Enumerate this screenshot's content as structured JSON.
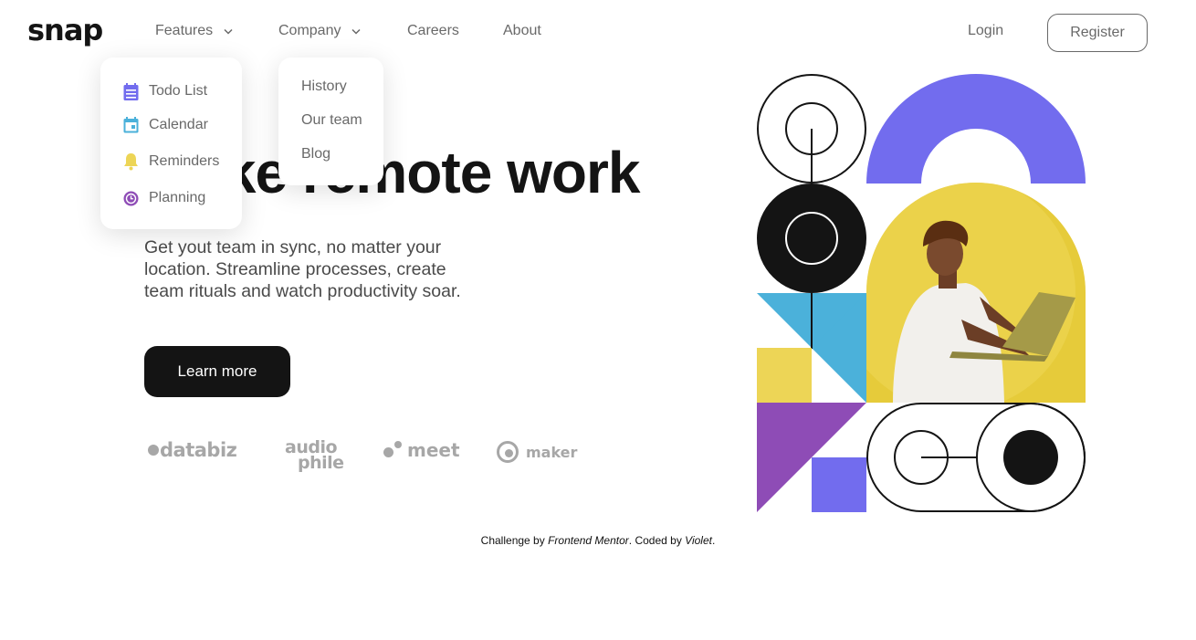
{
  "brand": {
    "logo": "snap"
  },
  "nav": {
    "features": "Features",
    "company": "Company",
    "careers": "Careers",
    "about": "About",
    "login": "Login",
    "register": "Register"
  },
  "features_menu": [
    {
      "label": "Todo List",
      "icon": "todo-icon",
      "color": "#726CEE"
    },
    {
      "label": "Calendar",
      "icon": "calendar-icon",
      "color": "#4BB1DA"
    },
    {
      "label": "Reminders",
      "icon": "bell-icon",
      "color": "#EDD556"
    },
    {
      "label": "Planning",
      "icon": "clock-icon",
      "color": "#8E4CB6"
    }
  ],
  "company_menu": [
    "History",
    "Our team",
    "Blog"
  ],
  "hero": {
    "title": "Make remote work",
    "text_lines": [
      "Get yout team in sync, no matter your",
      "location. Streamline processes, create",
      "team rituals and watch productivity soar."
    ],
    "cta": "Learn more"
  },
  "clients": {
    "databiz": "databiz",
    "audiophile_top": "audio",
    "audiophile_bottom": "phile",
    "meet": "meet",
    "maker": "maker"
  },
  "footer": {
    "prefix": "Challenge by ",
    "mentor": "Frontend Mentor",
    "middle": ". Coded by ",
    "author": "Violet",
    "suffix": "."
  },
  "colors": {
    "dark": "#141414",
    "purple_blue": "#726CEE",
    "sky_blue": "#4BB1DA",
    "yellow": "#EDD556",
    "purple": "#8E4CB6",
    "gray_text": "#696969",
    "logo_gray": "#A7A7A7"
  }
}
